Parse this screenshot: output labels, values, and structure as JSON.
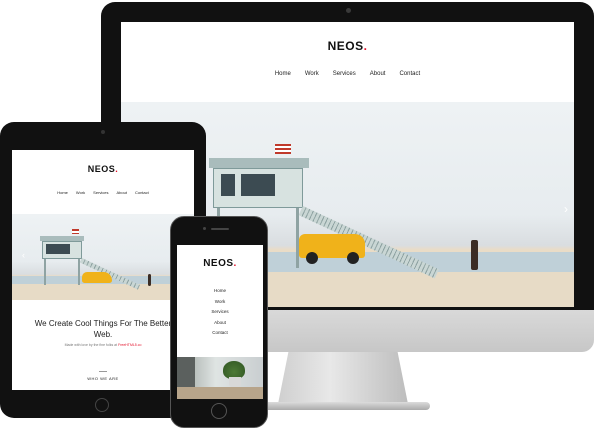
{
  "brand": {
    "name": "NEOS",
    "dot": "."
  },
  "desktop": {
    "nav": [
      "Home",
      "Work",
      "Services",
      "About",
      "Contact"
    ],
    "active": "Home",
    "slider_next": "›"
  },
  "tablet": {
    "nav": [
      "Home",
      "Work",
      "Services",
      "About",
      "Contact"
    ],
    "heading": "We Create Cool Things For The Better Web.",
    "sub_prefix": "Made with love by the fine folks at ",
    "sub_link": "FreeHTML5.co",
    "section_label": "WHO WE ARE",
    "slider_prev": "‹"
  },
  "phone": {
    "nav": [
      "Home",
      "Work",
      "Services",
      "About",
      "Contact"
    ]
  },
  "colors": {
    "accent": "#e3122b",
    "text": "#111111",
    "bezel": "#111111"
  }
}
